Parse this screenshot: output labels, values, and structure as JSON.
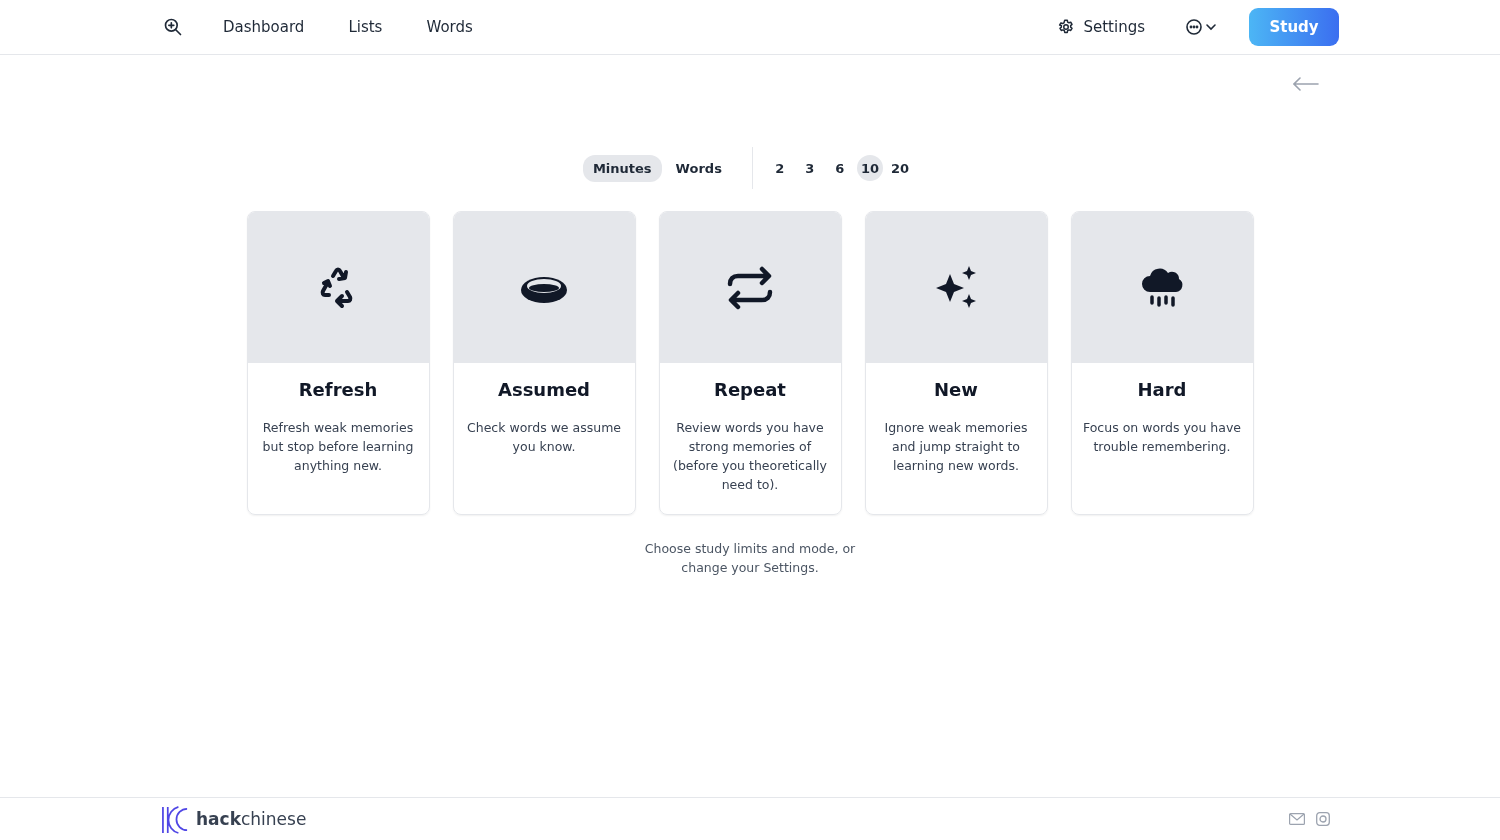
{
  "nav": {
    "links": [
      {
        "label": "Dashboard"
      },
      {
        "label": "Lists"
      },
      {
        "label": "Words"
      }
    ],
    "settings": "Settings",
    "study": "Study"
  },
  "modes": [
    {
      "label": "Minutes",
      "selected": true
    },
    {
      "label": "Words",
      "selected": false
    }
  ],
  "amounts": [
    {
      "label": "2",
      "selected": false
    },
    {
      "label": "3",
      "selected": false
    },
    {
      "label": "6",
      "selected": false
    },
    {
      "label": "10",
      "selected": true
    },
    {
      "label": "20",
      "selected": false
    }
  ],
  "cards": [
    {
      "kind": "recycle",
      "title": "Refresh",
      "description": "Refresh weak memories but stop before learning anything new."
    },
    {
      "kind": "ring",
      "title": "Assumed",
      "description": "Check words we assume you know."
    },
    {
      "kind": "repeat",
      "title": "Repeat",
      "description": "Review words you have strong memories of (before you theoretically need to)."
    },
    {
      "kind": "sparkles",
      "title": "New",
      "description": "Ignore weak memories and jump straight to learning new words."
    },
    {
      "kind": "rain",
      "title": "Hard",
      "description": "Focus on words you have trouble remembering."
    }
  ],
  "hint": "Choose study limits and mode, or change your Settings.",
  "footer": {
    "logo": "**hack**chinese"
  }
}
